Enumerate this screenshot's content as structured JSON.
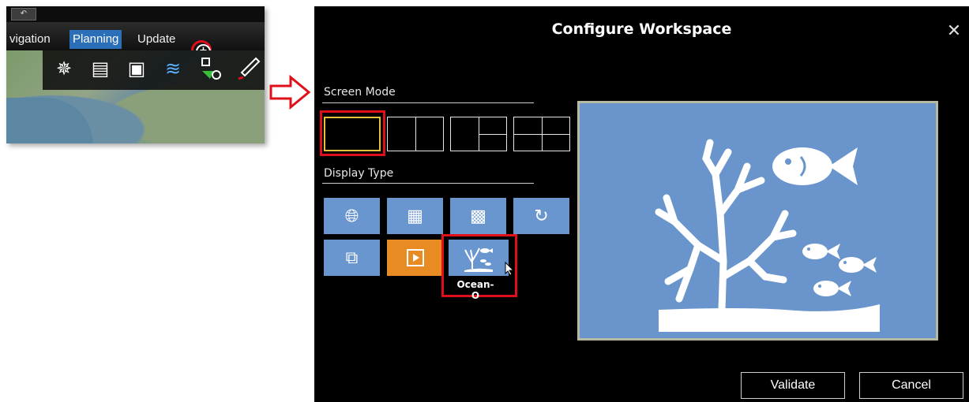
{
  "mini": {
    "tabs": [
      "vigation",
      "Planning",
      "Update"
    ],
    "plus_icon": "plus-circle-icon",
    "tools": [
      "compass-icon",
      "layers-icon",
      "chart-icon",
      "sonar-icon",
      "route-icon",
      "pen-icon"
    ]
  },
  "dialog": {
    "title": "Configure Workspace",
    "close_icon": "close-icon",
    "screen_mode": {
      "label": "Screen Mode",
      "modes": [
        "single",
        "two-vertical",
        "three-split",
        "four-grid"
      ],
      "selected": "single"
    },
    "display_type": {
      "label": "Display Type",
      "row1": [
        "globe-icon",
        "3d-map-icon",
        "chart-grid-icon",
        "refresh-icon"
      ],
      "row2": [
        "nav-chart-icon",
        "video-play-icon",
        "ocean-o-icon"
      ],
      "selected_name": "Ocean-O"
    },
    "preview_icon": "coral-and-fish-icon",
    "buttons": {
      "validate": "Validate",
      "cancel": "Cancel"
    }
  },
  "colors": {
    "dialog_bg": "#000000",
    "tile_blue": "#6a96cf",
    "tile_orange": "#e88b23",
    "highlight_red": "#e0101a",
    "selected_yellow": "#e8c13a",
    "planning_tab_blue": "#2a6fb8"
  }
}
